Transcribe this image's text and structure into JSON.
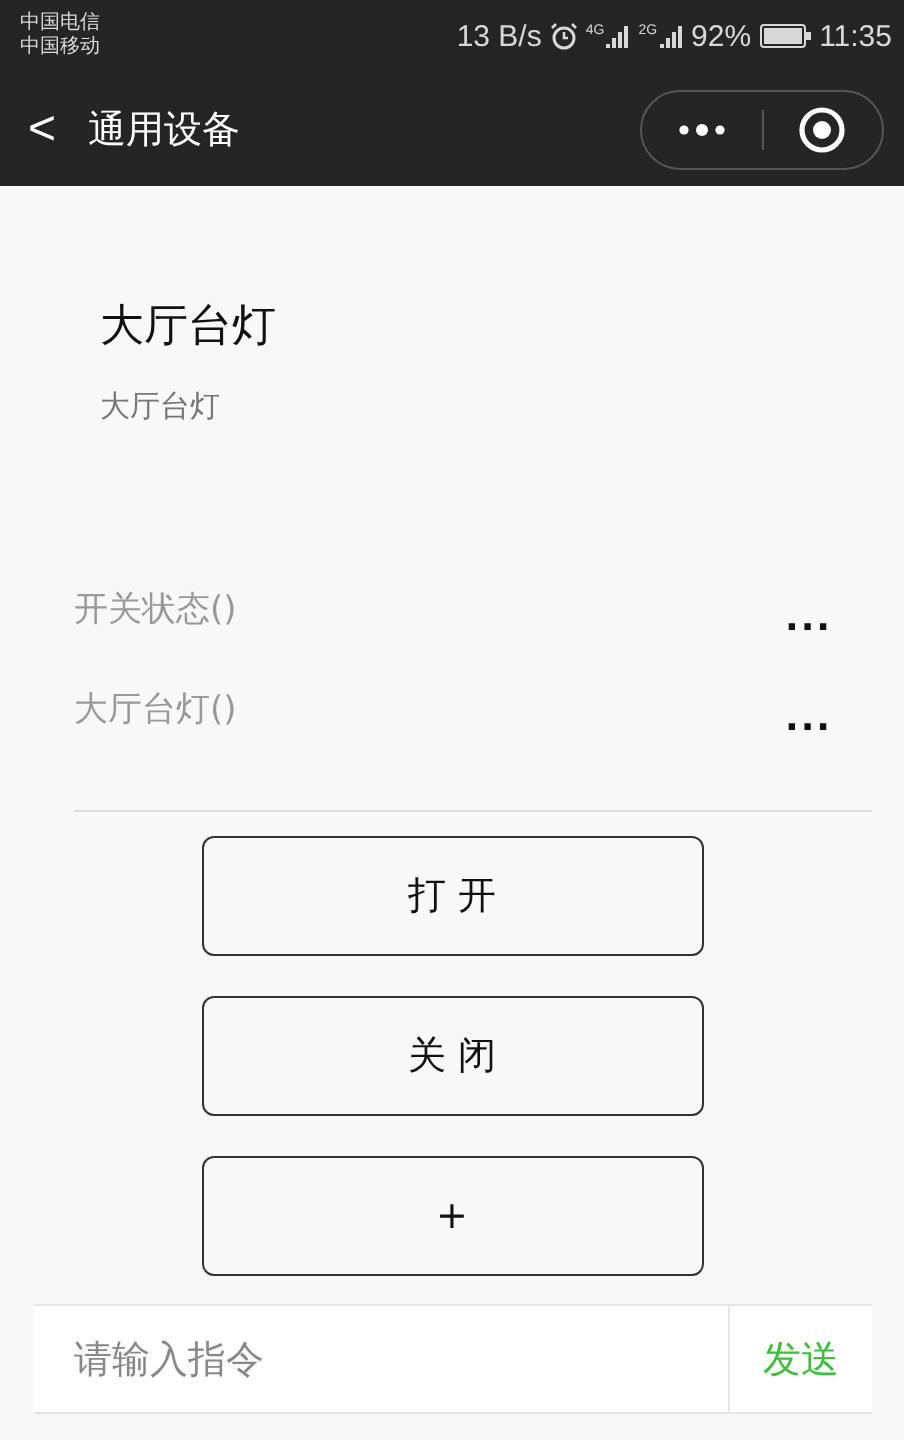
{
  "status_bar": {
    "carriers": [
      "中国电信",
      "中国移动"
    ],
    "speed": "13 B/s",
    "signal_labels": [
      "4G",
      "2G"
    ],
    "battery": "92%",
    "time": "11:35"
  },
  "nav": {
    "back": "<",
    "title": "通用设备"
  },
  "device": {
    "name": "大厅台灯",
    "subtitle": "大厅台灯"
  },
  "properties": [
    {
      "label": "开关状态()",
      "value": "..."
    },
    {
      "label": "大厅台灯()",
      "value": "..."
    }
  ],
  "buttons": [
    "打 开",
    "关 闭",
    "+"
  ],
  "command": {
    "placeholder": "请输入指令",
    "send": "发送"
  }
}
